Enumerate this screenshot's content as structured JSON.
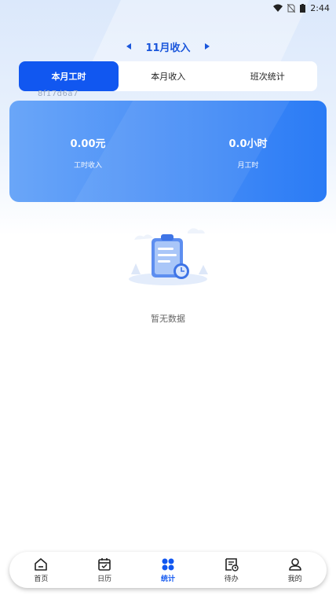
{
  "status_bar": {
    "time": "2:44"
  },
  "header": {
    "month_title": "11月收入"
  },
  "tabs": [
    {
      "label": "本月工时",
      "active": true
    },
    {
      "label": "本月收入",
      "active": false
    },
    {
      "label": "班次统计",
      "active": false
    }
  ],
  "watermark": "8f17d6a7",
  "summary": {
    "income_value": "0.00元",
    "income_label": "工时收入",
    "hours_value": "0.0小时",
    "hours_label": "月工时"
  },
  "empty_state": {
    "text": "暂无数据"
  },
  "bottom_nav": [
    {
      "label": "首页",
      "icon": "home-icon"
    },
    {
      "label": "日历",
      "icon": "calendar-icon"
    },
    {
      "label": "统计",
      "icon": "stats-icon",
      "active": true
    },
    {
      "label": "待办",
      "icon": "todo-icon"
    },
    {
      "label": "我的",
      "icon": "profile-icon"
    }
  ],
  "colors": {
    "accent": "#1157f0",
    "card_start": "#6aa6f8",
    "card_end": "#2a7bf5"
  }
}
